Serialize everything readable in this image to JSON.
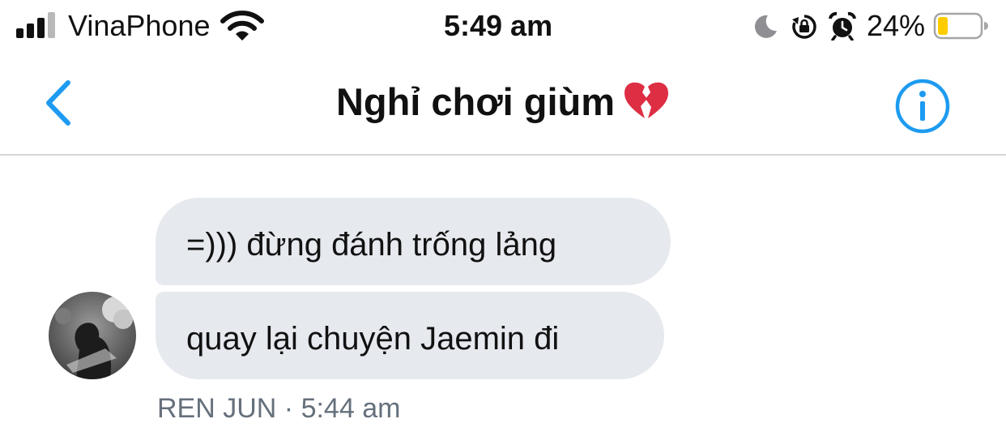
{
  "status_bar": {
    "carrier": "VinaPhone",
    "time": "5:49 am",
    "battery_percent": "24%",
    "battery_level": 0.24,
    "signal_bars_active": 3,
    "signal_bars_total": 4,
    "icons": [
      "signal-icon",
      "wifi-icon",
      "moon-icon",
      "orientation-lock-icon",
      "alarm-icon",
      "battery-icon"
    ]
  },
  "nav": {
    "title": "Nghỉ chơi giùm",
    "title_emoji": "broken-heart-icon",
    "back_icon": "chevron-left-icon",
    "info_icon": "info-icon",
    "accent_color": "#1d9bf0"
  },
  "messages": [
    {
      "text": "=))) đừng đánh trống lảng"
    },
    {
      "text": "quay lại chuyện Jaemin đi"
    }
  ],
  "meta": {
    "sender": "REN JUN",
    "separator": "·",
    "time": "5:44 am"
  },
  "colors": {
    "bubble": "#e6e9ee",
    "meta_text": "#66707c",
    "heart": "#dd2e44",
    "battery_fill": "#ffcc00"
  }
}
